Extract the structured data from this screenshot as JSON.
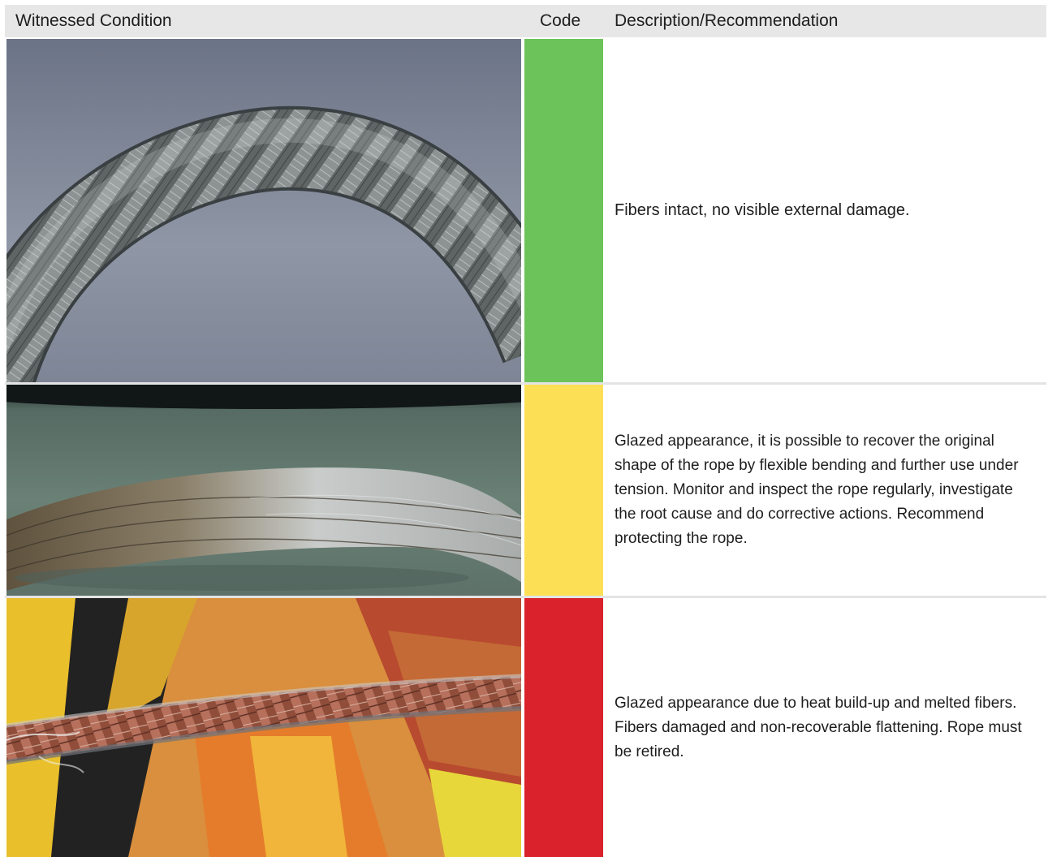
{
  "table": {
    "headers": {
      "condition": "Witnessed Condition",
      "code": "Code",
      "description": "Description/Recommendation"
    },
    "rows": [
      {
        "photo": "rope-intact-photo",
        "code_color": "#6cc35a",
        "description": "Fibers intact, no visible external damage."
      },
      {
        "photo": "rope-glazed-photo",
        "code_color": "#fddf55",
        "description": "Glazed appearance, it is possible to recover the original shape of the rope by flexible bending and further use under tension. Monitor and inspect the rope regularly, investigate the root cause and do corrective actions. Recommend protecting the rope."
      },
      {
        "photo": "rope-melted-photo",
        "code_color": "#d9222c",
        "description": "Glazed appearance due to heat build-up and melted fibers. Fibers damaged and non-recoverable flattening. Rope must be retired."
      }
    ]
  }
}
